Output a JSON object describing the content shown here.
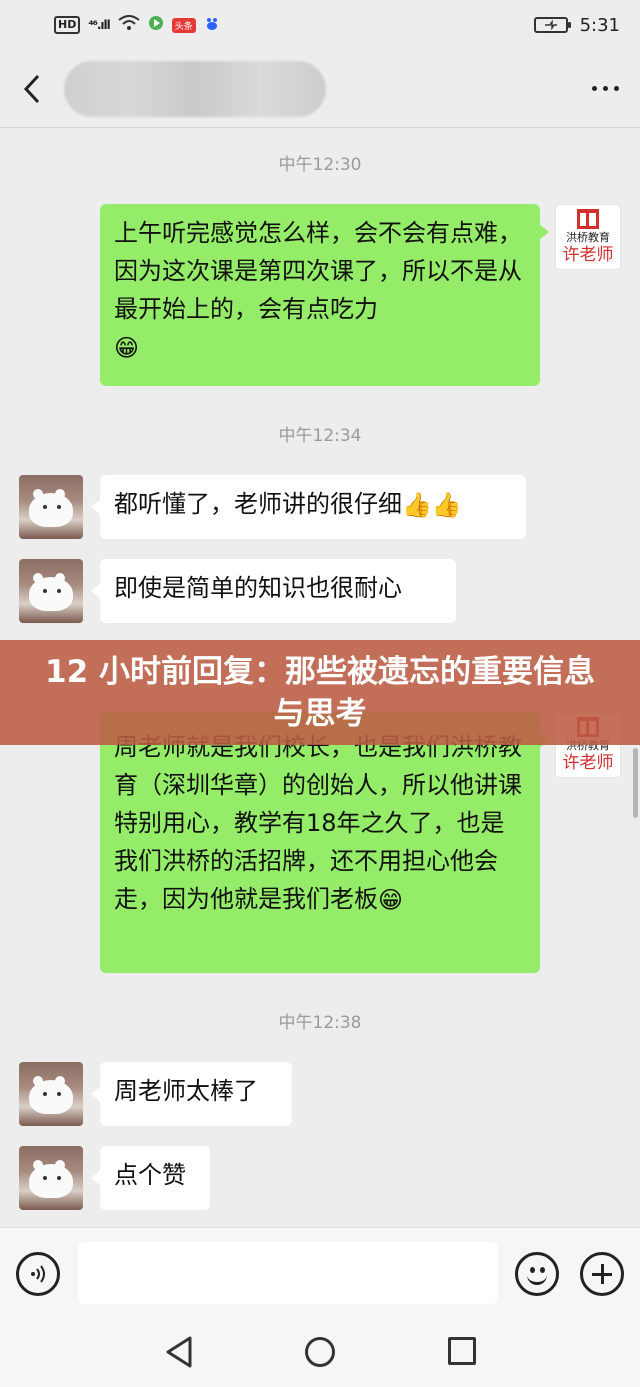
{
  "status_bar": {
    "hd_label": "HD",
    "network": "⁴⁶.ıll",
    "app_badge": "头条",
    "time": "5:31"
  },
  "header": {
    "back_icon": "chevron-left-icon",
    "more_icon": "more-dots-icon"
  },
  "messages": {
    "t1": "中午12:30",
    "m1_text": "上午听完感觉怎么样，会不会有点难，因为这次课是第四次课了，所以不是从最开始上的，会有点吃力",
    "m1_emoji": "😁",
    "t2": "中午12:34",
    "m2_text": "都听懂了，老师讲的很仔细",
    "m2_emoji": "👍👍",
    "m3_text": "即使是简单的知识也很耐心",
    "m4_text": "周老师就是我们校长，也是我们洪桥教育（深圳华章）的创始人，所以他讲课特别用心，教学有18年之久了，也是我们洪桥的活招牌，还不用担心他会走，因为他就是我们老板",
    "m4_emoji": "😁",
    "t3": "中午12:38",
    "m5_text": "周老师太棒了",
    "m6_text": "点个赞"
  },
  "teacher_avatar": {
    "org": "洪桥教育",
    "name": "许老师",
    "brand_color": "#d32f2f"
  },
  "banner": {
    "text": "12 小时前回复：那些被遗忘的重要信息与思考"
  },
  "input_bar": {
    "voice_icon": "voice-icon",
    "emoji_icon": "emoji-icon",
    "plus_icon": "plus-icon",
    "input_value": ""
  },
  "colors": {
    "my_bubble": "#95ec69",
    "their_bubble": "#ffffff",
    "background": "#ededed",
    "banner": "#bc5c44"
  }
}
